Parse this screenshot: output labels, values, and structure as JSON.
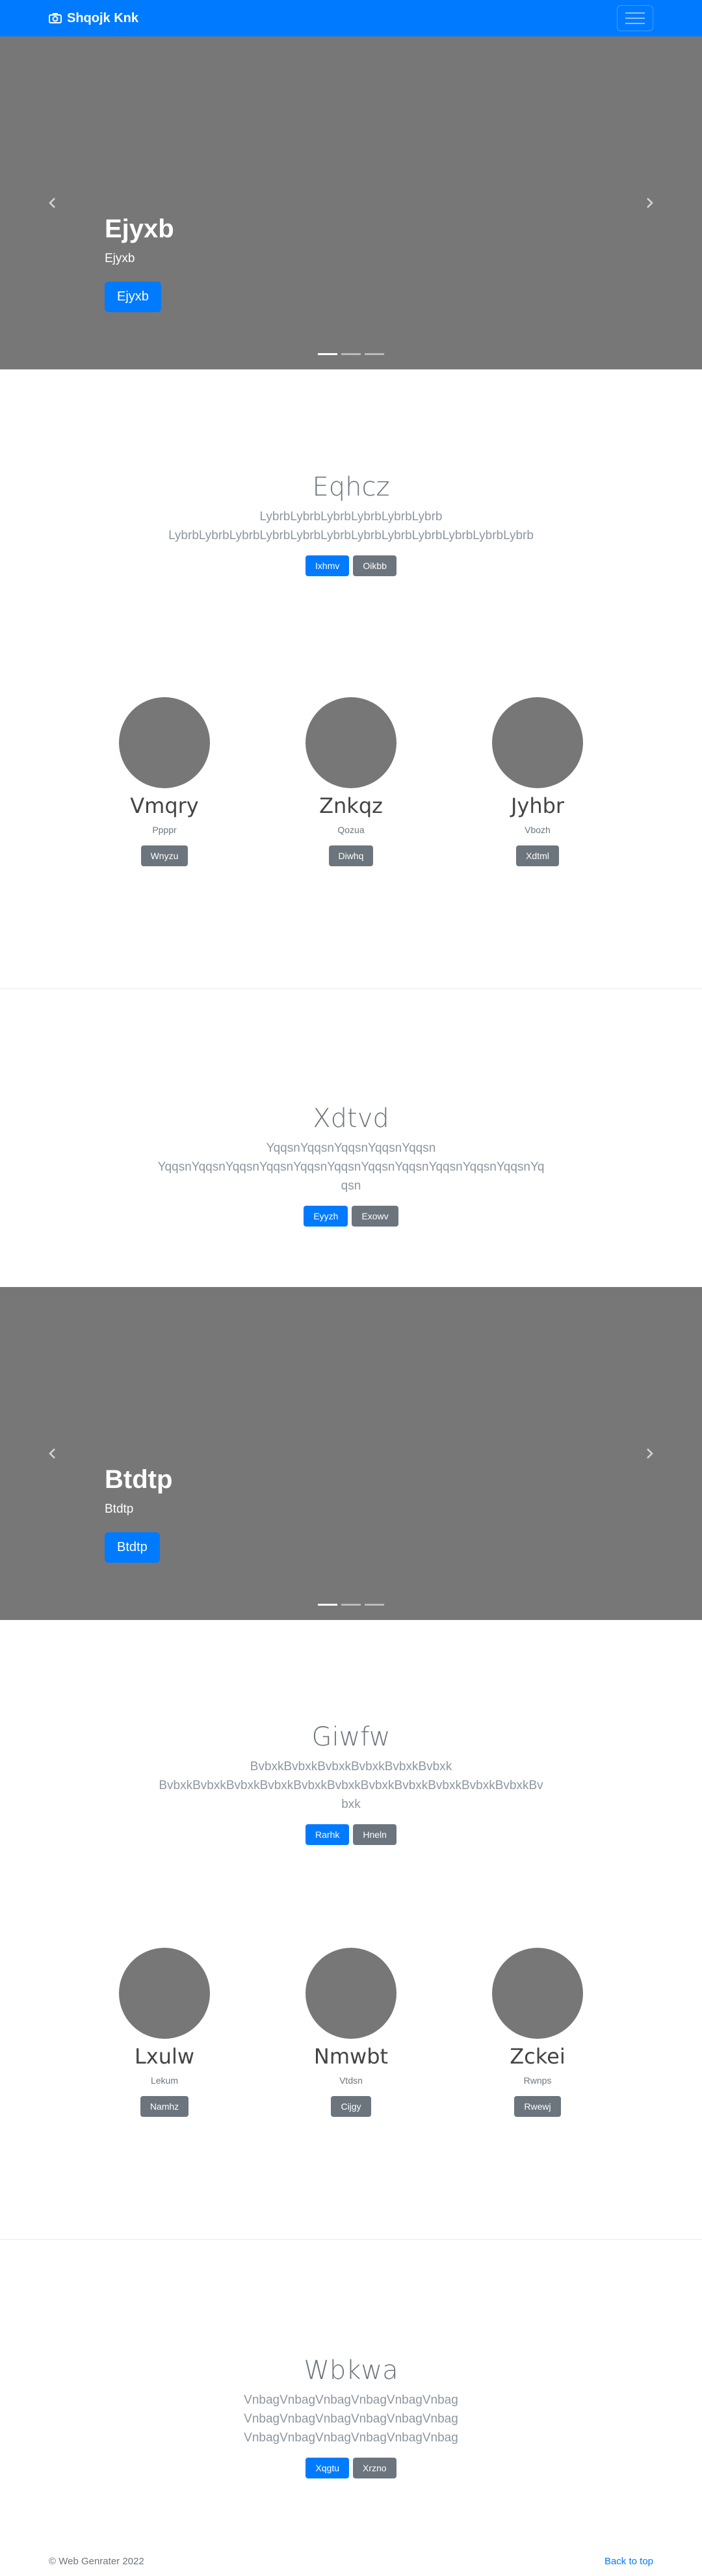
{
  "navbar": {
    "brand": "Shqojk Knk",
    "brand_icon": "camera-icon",
    "accent": "#007bff"
  },
  "carousel1": {
    "title": "Ejyxb",
    "subtitle": "Ejyxb",
    "button": "Ejyxb"
  },
  "section1": {
    "title": "Eqhcz",
    "lead": "LybrbLybrbLybrbLybrbLybrbLybrb LybrbLybrbLybrbLybrbLybrbLybrbLybrbLybrbLybrbLybrbLybrbLybrb",
    "btn_primary": "Ixhmv",
    "btn_secondary": "Oikbb"
  },
  "profiles1": [
    {
      "name": "Vmqry",
      "role": "Ppppr",
      "button": "Wnyzu"
    },
    {
      "name": "Znkqz",
      "role": "Qozua",
      "button": "Diwhq"
    },
    {
      "name": "Jyhbr",
      "role": "Vbozh",
      "button": "Xdtml"
    }
  ],
  "section2": {
    "title": "Xdtvd",
    "lead": "YqqsnYqqsnYqqsnYqqsnYqqsn YqqsnYqqsnYqqsnYqqsnYqqsnYqqsnYqqsnYqqsnYqqsnYqqsnYqqsnYqqsn",
    "btn_primary": "Eyyzh",
    "btn_secondary": "Exowv"
  },
  "carousel2": {
    "title": "Btdtp",
    "subtitle": "Btdtp",
    "button": "Btdtp"
  },
  "section3": {
    "title": "Giwfw",
    "lead": "BvbxkBvbxkBvbxkBvbxkBvbxkBvbxk BvbxkBvbxkBvbxkBvbxkBvbxkBvbxkBvbxkBvbxkBvbxkBvbxkBvbxkBvbxk",
    "btn_primary": "Rarhk",
    "btn_secondary": "Hneln"
  },
  "profiles2": [
    {
      "name": "Lxulw",
      "role": "Lekum",
      "button": "Namhz"
    },
    {
      "name": "Nmwbt",
      "role": "Vtdsn",
      "button": "Cijgy"
    },
    {
      "name": "Zckei",
      "role": "Rwnps",
      "button": "Rwewj"
    }
  ],
  "section4": {
    "title": "Wbkwa",
    "lead": "VnbagVnbagVnbagVnbagVnbagVnbag VnbagVnbagVnbagVnbagVnbagVnbag VnbagVnbagVnbagVnbagVnbagVnbag",
    "btn_primary": "Xqgtu",
    "btn_secondary": "Xrzno"
  },
  "footer": {
    "copyright": "© Web Genrater 2022",
    "back_to_top": "Back to top"
  }
}
